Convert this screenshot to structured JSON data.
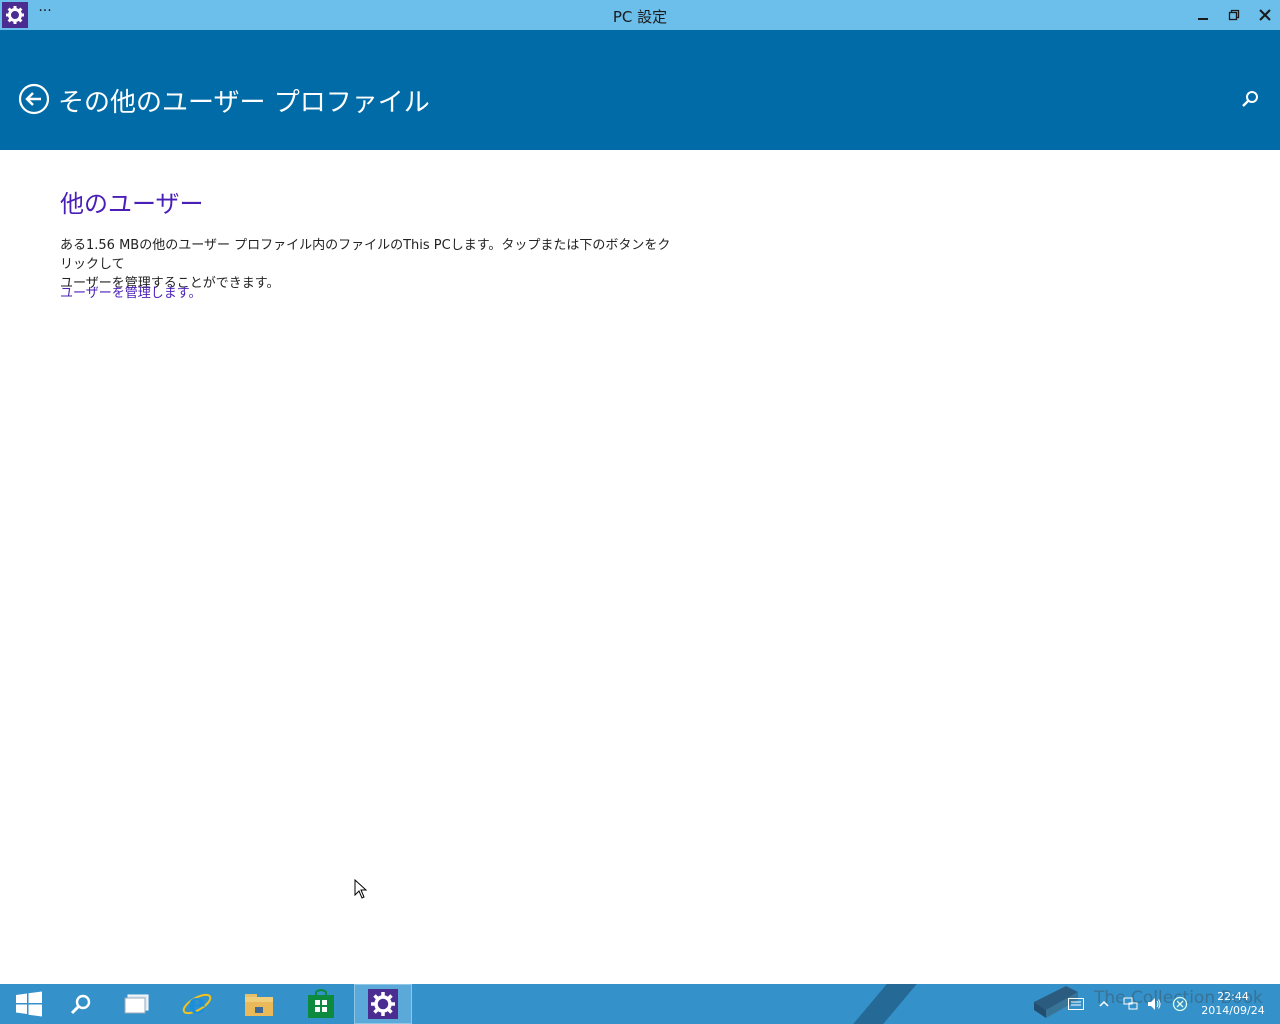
{
  "window": {
    "title": "PC 設定",
    "menu_label": "···"
  },
  "header": {
    "title": "その他のユーザー プロファイル"
  },
  "content": {
    "heading": "他のユーザー",
    "description_line1": "ある1.56 MBの他のユーザー プロファイル内のファイルのThis PCします。タップまたは下のボタンをクリックして",
    "description_line2": "ユーザーを管理することができます。",
    "link": "ユーザーを管理します。"
  },
  "taskbar": {
    "items": [
      {
        "name": "start-button",
        "icon": "windows-logo-icon"
      },
      {
        "name": "search-button",
        "icon": "search-icon"
      },
      {
        "name": "task-view-button",
        "icon": "task-view-icon"
      },
      {
        "name": "internet-explorer",
        "icon": "internet-explorer-icon"
      },
      {
        "name": "file-explorer",
        "icon": "folder-icon"
      },
      {
        "name": "store",
        "icon": "store-icon"
      },
      {
        "name": "pc-settings",
        "icon": "gear-icon",
        "active": true
      }
    ],
    "watermark": "The Collection Book",
    "clock_time": "22:44",
    "clock_date": "2014/09/24"
  },
  "colors": {
    "titlebar": "#6bbfea",
    "header": "#016ba7",
    "accent_text": "#4a1fb8",
    "taskbar": "#3491c9"
  }
}
